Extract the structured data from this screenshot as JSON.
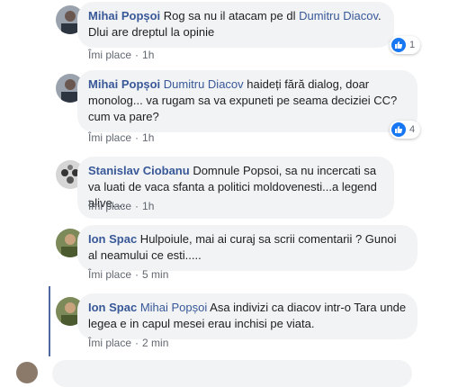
{
  "comments": [
    {
      "author": "Mihai Popșoi",
      "tag": "",
      "text_before_tag": "Rog sa nu il atacam pe dl ",
      "tag_inline": "Dumitru Diacov",
      "text_after_tag": ". Dlui are dreptul la opinie",
      "like_label": "Îmi place",
      "time": "1h",
      "reaction_count": "1"
    },
    {
      "author": "Mihai Popșoi",
      "tag": "Dumitru Diacov",
      "text": " haideți fără dialog, doar monolog... va rugam sa va expuneti pe seama deciziei CC? cum va pare?",
      "like_label": "Îmi place",
      "time": "1h",
      "reaction_count": "4"
    },
    {
      "author": "Stanislav Ciobanu",
      "tag": "",
      "text": " Domnule Popsoi, sa nu incercati sa va luati de vaca sfanta a politici moldovenesti...a legend alive....",
      "like_label": "Îmi place",
      "time": "1h"
    },
    {
      "author": "Ion Spac",
      "tag": "",
      "text": " Hulpoiule, mai ai curaj sa scrii comentarii ? Gunoi al neamului ce esti.....",
      "like_label": "Îmi place",
      "time": "5 min"
    },
    {
      "author": "Ion Spac",
      "tag": "Mihai Popșoi",
      "text": " Asa indivizi ca diacov intr-o Tara unde legea e in capul mesei erau inchisi pe viata.",
      "like_label": "Îmi place",
      "time": "2 min"
    }
  ],
  "colors": {
    "author": "#385898",
    "bubble": "#f2f3f5",
    "like_blue": "#1877f2",
    "meta": "#616770"
  }
}
